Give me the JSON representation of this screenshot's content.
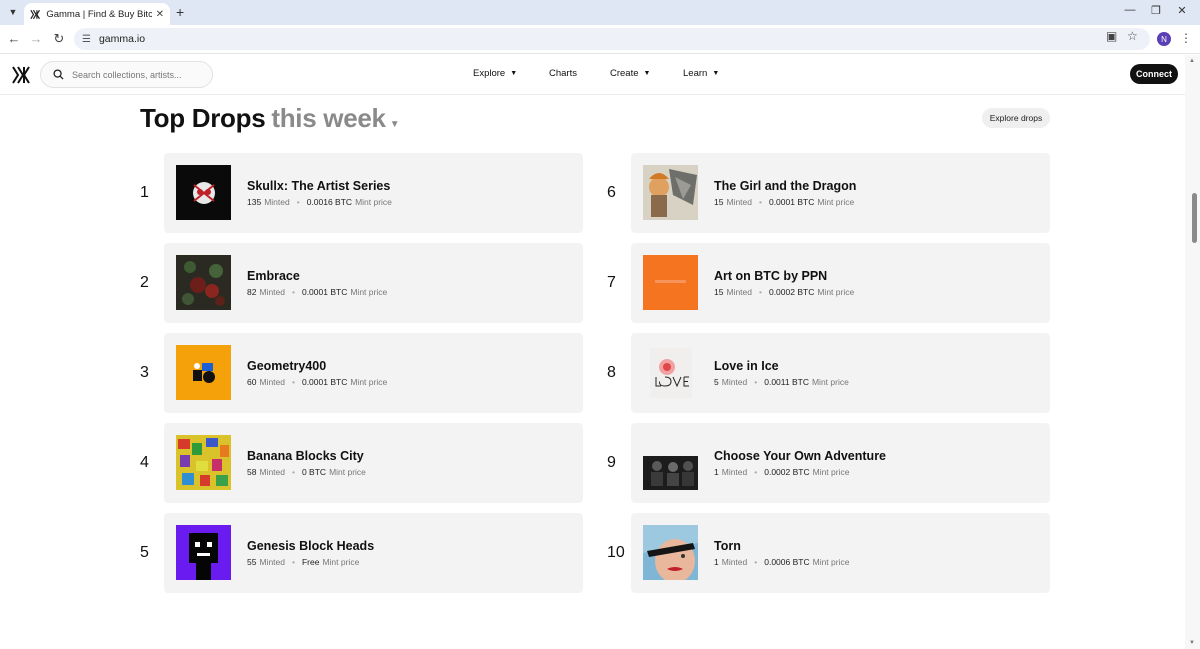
{
  "browser": {
    "tab_title": "Gamma | Find & Buy Bitcoin Or",
    "url": "gamma.io",
    "profile_initial": "N"
  },
  "header": {
    "search_placeholder": "Search collections, artists...",
    "nav": [
      {
        "label": "Explore",
        "dropdown": true
      },
      {
        "label": "Charts",
        "dropdown": false
      },
      {
        "label": "Create",
        "dropdown": true
      },
      {
        "label": "Learn",
        "dropdown": true
      }
    ],
    "connect_label": "Connect"
  },
  "page": {
    "title": "Top Drops",
    "period": "this week",
    "explore_label": "Explore drops"
  },
  "meta_labels": {
    "minted": "Minted",
    "mint_price": "Mint price"
  },
  "drops": [
    {
      "rank": "1",
      "name": "Skullx: The Artist Series",
      "minted": "135",
      "price": "0.0016 BTC"
    },
    {
      "rank": "2",
      "name": "Embrace",
      "minted": "82",
      "price": "0.0001 BTC"
    },
    {
      "rank": "3",
      "name": "Geometry400",
      "minted": "60",
      "price": "0.0001 BTC"
    },
    {
      "rank": "4",
      "name": "Banana Blocks City",
      "minted": "58",
      "price": "0 BTC"
    },
    {
      "rank": "5",
      "name": "Genesis Block Heads",
      "minted": "55",
      "price": "Free"
    },
    {
      "rank": "6",
      "name": "The Girl and the Dragon",
      "minted": "15",
      "price": "0.0001 BTC"
    },
    {
      "rank": "7",
      "name": "Art on BTC by PPN",
      "minted": "15",
      "price": "0.0002 BTC"
    },
    {
      "rank": "8",
      "name": "Love in Ice",
      "minted": "5",
      "price": "0.0011 BTC"
    },
    {
      "rank": "9",
      "name": "Choose Your Own Adventure",
      "minted": "1",
      "price": "0.0002 BTC"
    },
    {
      "rank": "10",
      "name": "Torn",
      "minted": "1",
      "price": "0.0006 BTC"
    }
  ],
  "colors": {
    "card_bg": "#f3f3f3",
    "accent": "#111111",
    "muted": "#8a8a8a",
    "profile": "#5b3fb7"
  }
}
